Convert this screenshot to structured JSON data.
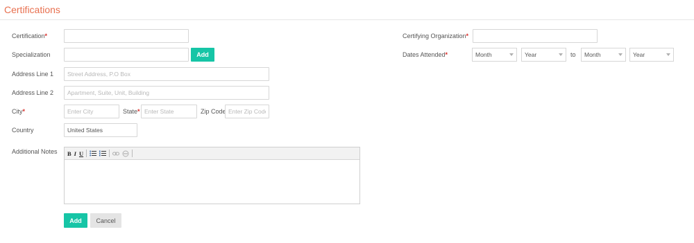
{
  "page": {
    "title": "Certifications"
  },
  "form": {
    "certification": {
      "label": "Certification",
      "required_mark": "*",
      "value": "",
      "placeholder": ""
    },
    "specialization": {
      "label": "Specialization",
      "value": "",
      "placeholder": "",
      "add_label": "Add"
    },
    "address1": {
      "label": "Address Line 1",
      "value": "",
      "placeholder": "Street Address, P.O Box"
    },
    "address2": {
      "label": "Address Line 2",
      "value": "",
      "placeholder": "Apartment, Suite, Unit, Building"
    },
    "city": {
      "label": "City",
      "required_mark": "*",
      "value": "",
      "placeholder": "Enter City"
    },
    "state": {
      "label": "State",
      "required_mark": "*",
      "value": "",
      "placeholder": "Enter State"
    },
    "zip": {
      "label": "Zip Code",
      "value": "",
      "placeholder": "Enter Zip Code"
    },
    "country": {
      "label": "Country",
      "value": "United States"
    },
    "notes": {
      "label": "Additional Notes",
      "toolbar": {
        "bold": "B",
        "italic": "I",
        "underline": "U"
      }
    },
    "certifying_org": {
      "label": "Certifying Organization",
      "required_mark": "*",
      "value": "",
      "placeholder": ""
    },
    "dates": {
      "label": "Dates Attended",
      "required_mark": "*",
      "start_month": "Month",
      "start_year": "Year",
      "to_label": "to",
      "end_month": "Month",
      "end_year": "Year"
    }
  },
  "actions": {
    "add_label": "Add",
    "cancel_label": "Cancel"
  },
  "colors": {
    "accent": "#16c5a6",
    "title": "#e8704f",
    "required": "#d9302c"
  }
}
